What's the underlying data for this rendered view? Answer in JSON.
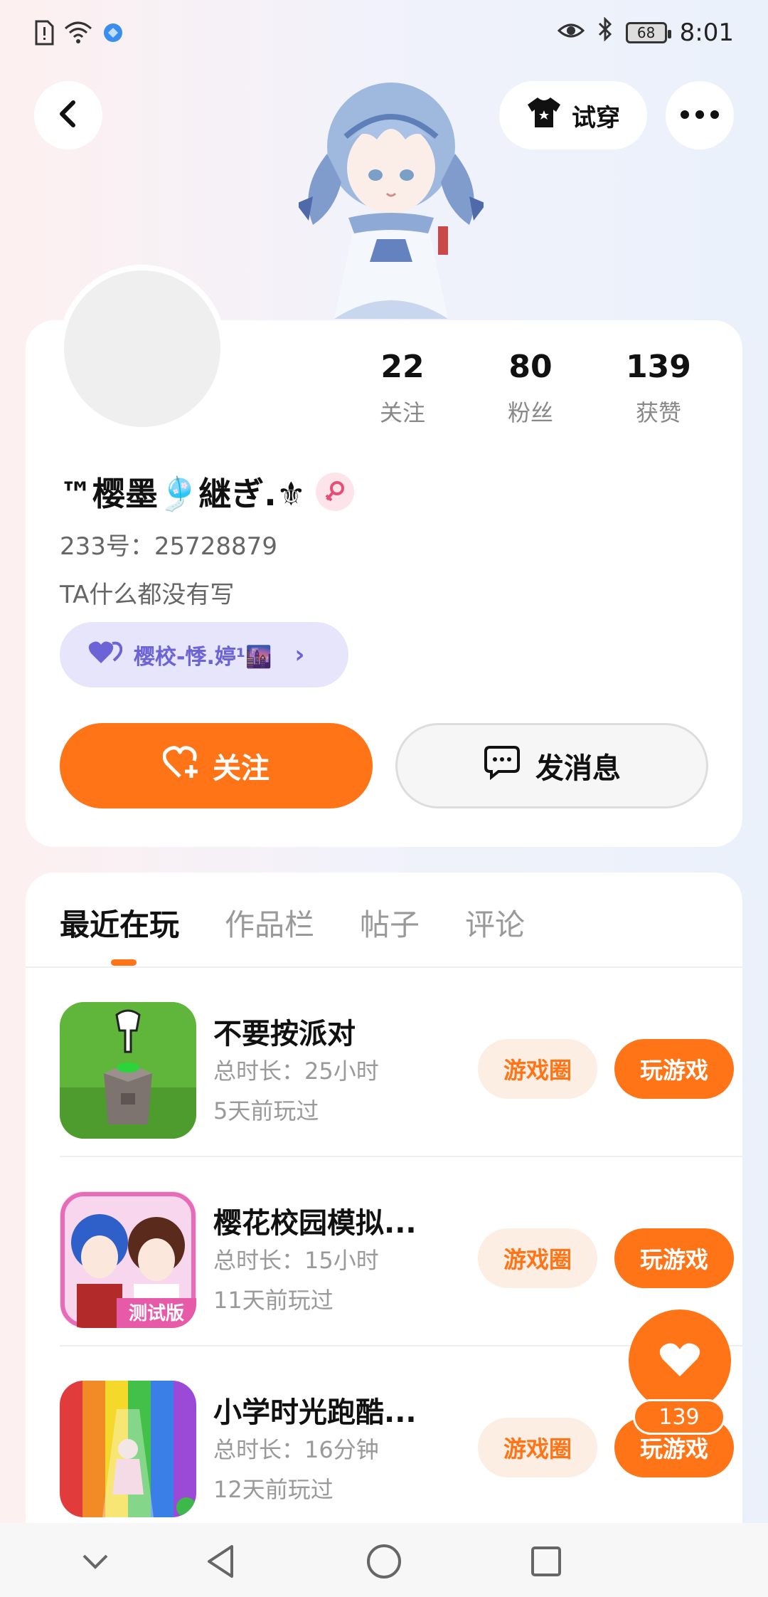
{
  "status_bar": {
    "time": "8:01",
    "battery": "68"
  },
  "header": {
    "tryon_label": "试穿"
  },
  "stats": [
    {
      "value": "22",
      "label": "关注"
    },
    {
      "value": "80",
      "label": "粉丝"
    },
    {
      "value": "139",
      "label": "获赞"
    }
  ],
  "profile": {
    "username": "™樱墨🎐継ぎ.⚜",
    "uid": "233号：25728879",
    "bio": "TA什么都没有写",
    "family": "樱校-悸.婷¹🌆"
  },
  "actions": {
    "follow": "关注",
    "message": "发消息"
  },
  "tabs": [
    "最近在玩",
    "作品栏",
    "帖子",
    "评论"
  ],
  "games": [
    {
      "title": "不要按派对",
      "duration": "总时长：25小时",
      "last_played": "5天前玩过",
      "circle": "游戏圈",
      "play": "玩游戏"
    },
    {
      "title": "樱花校园模拟...",
      "duration": "总时长：15小时",
      "last_played": "11天前玩过",
      "circle": "游戏圈",
      "play": "玩游戏",
      "badge": "测试版"
    },
    {
      "title": "小学时光跑酷...",
      "duration": "总时长：16分钟",
      "last_played": "12天前玩过",
      "circle": "游戏圈",
      "play": "玩游戏"
    }
  ],
  "like_fab": {
    "count": "139"
  },
  "colors": {
    "accent": "#ff7416",
    "family_pill": "#e6e5fb",
    "family_text": "#6b63d6"
  }
}
